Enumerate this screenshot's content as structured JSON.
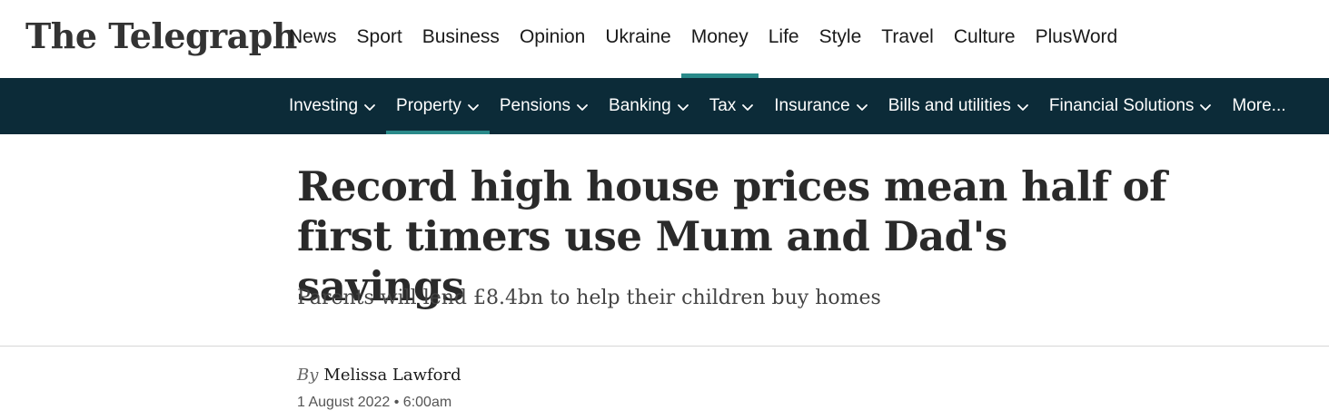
{
  "brand": {
    "logo_text": "The Telegraph"
  },
  "main_nav": [
    {
      "label": "News"
    },
    {
      "label": "Sport"
    },
    {
      "label": "Business"
    },
    {
      "label": "Opinion"
    },
    {
      "label": "Ukraine"
    },
    {
      "label": "Money",
      "active": true
    },
    {
      "label": "Life"
    },
    {
      "label": "Style"
    },
    {
      "label": "Travel"
    },
    {
      "label": "Culture"
    },
    {
      "label": "PlusWord"
    }
  ],
  "sub_nav": [
    {
      "label": "Investing",
      "dropdown": true
    },
    {
      "label": "Property",
      "dropdown": true,
      "active": true
    },
    {
      "label": "Pensions",
      "dropdown": true
    },
    {
      "label": "Banking",
      "dropdown": true
    },
    {
      "label": "Tax",
      "dropdown": true
    },
    {
      "label": "Insurance",
      "dropdown": true
    },
    {
      "label": "Bills and utilities",
      "dropdown": true
    },
    {
      "label": "Financial Solutions",
      "dropdown": true
    },
    {
      "label": "More...",
      "dropdown": false
    }
  ],
  "article": {
    "headline": "Record high house prices mean half of first timers use Mum and Dad's savings",
    "standfirst": "Parents will lend £8.4bn to help their children buy homes",
    "by_prefix": "By",
    "author": "Melissa Lawford",
    "date": "1 August 2022 • 6:00am"
  },
  "colors": {
    "subnav_background": "#0c2b38",
    "active_indicator": "#2a8a8a"
  }
}
